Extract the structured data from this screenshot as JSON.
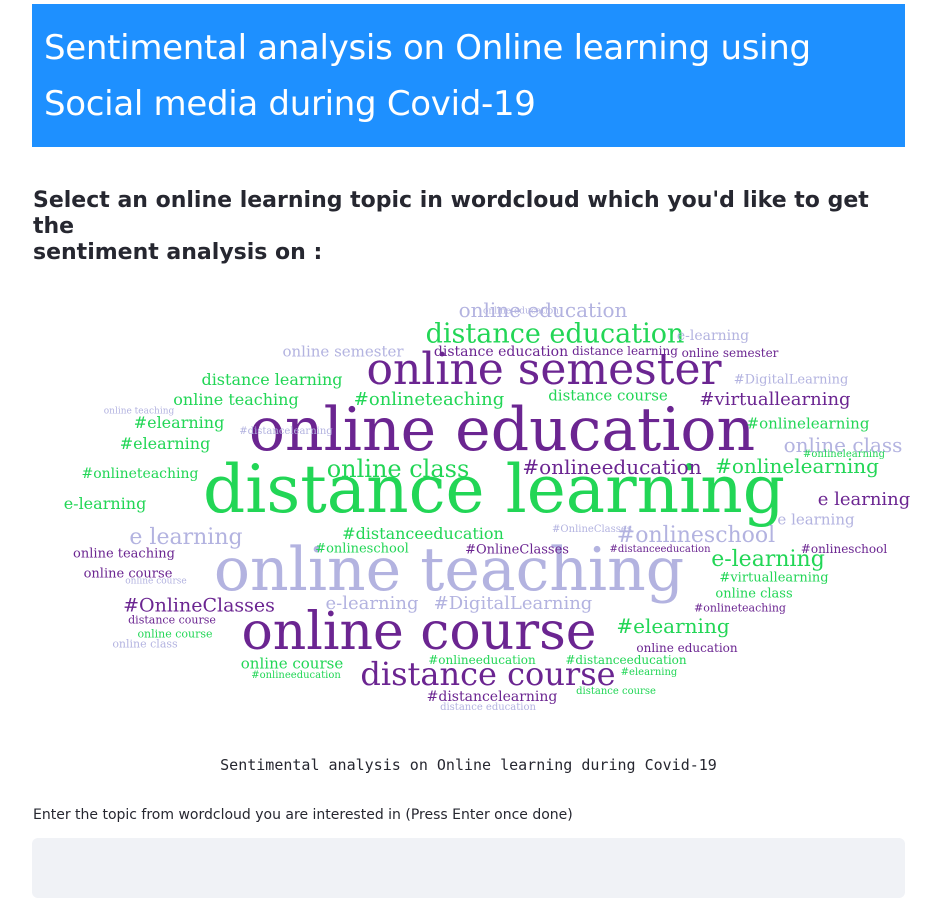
{
  "header": {
    "title_line1": "Sentimental analysis on Online learning using",
    "title_line2": "Social media during Covid-19",
    "background": "#1e90ff"
  },
  "prompt": {
    "line1": "Select an online learning topic in wordcloud which you'd like to get the",
    "line2": "sentiment analysis on :"
  },
  "wordcloud": {
    "colors": {
      "purple": "#6b2591",
      "green": "#22d656",
      "lavender": "#b3b3e0"
    },
    "words": [
      {
        "text": "online education",
        "color": "lavender",
        "size": 20
      },
      {
        "text": "distance education",
        "color": "green",
        "size": 27
      },
      {
        "text": "online semester",
        "color": "purple",
        "size": 44
      },
      {
        "text": "online education",
        "color": "purple",
        "size": 60
      },
      {
        "text": "distance learning",
        "color": "green",
        "size": 66
      },
      {
        "text": "online teaching",
        "color": "lavender",
        "size": 60
      },
      {
        "text": "online course",
        "color": "purple",
        "size": 52
      },
      {
        "text": "distance course",
        "color": "purple",
        "size": 32
      },
      {
        "text": "online semester",
        "color": "lavender",
        "size": 15
      },
      {
        "text": "distance education",
        "color": "purple",
        "size": 14
      },
      {
        "text": "distance learning",
        "color": "purple",
        "size": 12
      },
      {
        "text": "online semester",
        "color": "purple",
        "size": 12
      },
      {
        "text": "e-learning",
        "color": "lavender",
        "size": 14
      },
      {
        "text": "distance learning",
        "color": "green",
        "size": 16
      },
      {
        "text": "online teaching",
        "color": "green",
        "size": 16
      },
      {
        "text": "#onlineteaching",
        "color": "green",
        "size": 18
      },
      {
        "text": "distance course",
        "color": "green",
        "size": 15
      },
      {
        "text": "#virtuallearning",
        "color": "purple",
        "size": 18
      },
      {
        "text": "#DigitalLearning",
        "color": "lavender",
        "size": 13
      },
      {
        "text": "#elearning",
        "color": "green",
        "size": 16
      },
      {
        "text": "#elearning",
        "color": "green",
        "size": 16
      },
      {
        "text": "#onlinelearning",
        "color": "green",
        "size": 15
      },
      {
        "text": "online class",
        "color": "lavender",
        "size": 20
      },
      {
        "text": "online class",
        "color": "green",
        "size": 24
      },
      {
        "text": "#onlineeducation",
        "color": "purple",
        "size": 20
      },
      {
        "text": "#onlinelearning",
        "color": "green",
        "size": 20
      },
      {
        "text": "#onlineteaching",
        "color": "green",
        "size": 14
      },
      {
        "text": "e learning",
        "color": "purple",
        "size": 18
      },
      {
        "text": "e-learning",
        "color": "green",
        "size": 16
      },
      {
        "text": "e learning",
        "color": "lavender",
        "size": 15
      },
      {
        "text": "#distanceeducation",
        "color": "green",
        "size": 16
      },
      {
        "text": "#onlineschool",
        "color": "lavender",
        "size": 22
      },
      {
        "text": "e learning",
        "color": "lavender",
        "size": 22
      },
      {
        "text": "#onlineschool",
        "color": "green",
        "size": 13
      },
      {
        "text": "#OnlineClasses",
        "color": "purple",
        "size": 13
      },
      {
        "text": "e-learning",
        "color": "green",
        "size": 22
      },
      {
        "text": "#onlineschool",
        "color": "purple",
        "size": 12
      },
      {
        "text": "online teaching",
        "color": "purple",
        "size": 13
      },
      {
        "text": "online course",
        "color": "purple",
        "size": 13
      },
      {
        "text": "#virtuallearning",
        "color": "green",
        "size": 13
      },
      {
        "text": "#OnlineClasses",
        "color": "purple",
        "size": 19
      },
      {
        "text": "e-learning",
        "color": "lavender",
        "size": 18
      },
      {
        "text": "#DigitalLearning",
        "color": "lavender",
        "size": 18
      },
      {
        "text": "online class",
        "color": "green",
        "size": 13
      },
      {
        "text": "#onlineteaching",
        "color": "purple",
        "size": 11
      },
      {
        "text": "#elearning",
        "color": "green",
        "size": 20
      },
      {
        "text": "distance course",
        "color": "purple",
        "size": 11
      },
      {
        "text": "online course",
        "color": "green",
        "size": 11
      },
      {
        "text": "online education",
        "color": "purple",
        "size": 12
      },
      {
        "text": "online course",
        "color": "green",
        "size": 15
      },
      {
        "text": "#onlineeducation",
        "color": "green",
        "size": 12
      },
      {
        "text": "#distanceeducation",
        "color": "green",
        "size": 12
      },
      {
        "text": "#onlineeducation",
        "color": "green",
        "size": 10
      },
      {
        "text": "#distancelearning",
        "color": "purple",
        "size": 14
      },
      {
        "text": "distance education",
        "color": "lavender",
        "size": 10
      },
      {
        "text": "online class",
        "color": "lavender",
        "size": 11
      },
      {
        "text": "#distancelearning",
        "color": "lavender",
        "size": 10
      },
      {
        "text": "online education",
        "color": "lavender",
        "size": 9
      },
      {
        "text": "#onlinelearning",
        "color": "green",
        "size": 10
      },
      {
        "text": "#elearning",
        "color": "green",
        "size": 10
      },
      {
        "text": "#distanceeducation",
        "color": "purple",
        "size": 10
      },
      {
        "text": "#OnlineClasses",
        "color": "lavender",
        "size": 10
      },
      {
        "text": "online teaching",
        "color": "lavender",
        "size": 9
      },
      {
        "text": "distance course",
        "color": "green",
        "size": 10
      },
      {
        "text": "online course",
        "color": "lavender",
        "size": 9
      }
    ]
  },
  "caption": "Sentimental analysis on Online learning during Covid-19",
  "topic_field": {
    "label": "Enter the topic from wordcloud you are interested in (Press Enter once done)",
    "value": "",
    "background": "#f0f2f6"
  }
}
